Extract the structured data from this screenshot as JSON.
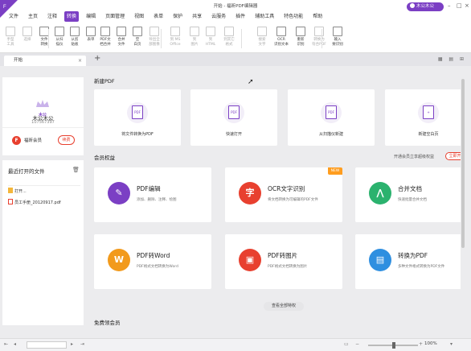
{
  "window": {
    "title": "开始 - 福昕PDF编辑器",
    "user_pill": "木公木公"
  },
  "menu": [
    "文件",
    "主页",
    "注释",
    "转换",
    "编辑",
    "页面管理",
    "视图",
    "表单",
    "保护",
    "共享",
    "云服务",
    "插件",
    "辅助工具",
    "特色功能",
    "帮助"
  ],
  "menu_active_index": 3,
  "toolbar": {
    "items": [
      {
        "label": "手型\n工具",
        "enabled": false
      },
      {
        "label": "选择",
        "enabled": false
      },
      {
        "label": "文件\n转换",
        "enabled": true
      },
      {
        "label": "从扫\n描仪",
        "enabled": true
      },
      {
        "label": "从剪\n贴板",
        "enabled": true
      },
      {
        "label": "表单",
        "enabled": true
      },
      {
        "label": "PDF文\n档合并",
        "enabled": true
      },
      {
        "label": "合并\n文件",
        "enabled": true
      },
      {
        "label": "空\n白页",
        "enabled": true
      },
      {
        "label": "导出全\n部图像",
        "enabled": false
      },
      {
        "label": "到 MS\nOffice",
        "enabled": false
      },
      {
        "label": "到\n图片",
        "enabled": false
      },
      {
        "label": "到\nHTML",
        "enabled": false
      },
      {
        "label": "到其它\n格式",
        "enabled": false
      },
      {
        "label": "搜索\n文字",
        "enabled": false
      },
      {
        "label": "OCR\n识别文本",
        "enabled": true
      },
      {
        "label": "重新\n识别",
        "enabled": true
      },
      {
        "label": "转换为\n符合PDF",
        "enabled": false
      },
      {
        "label": "输入\n要识别",
        "enabled": true
      }
    ]
  },
  "tabs": {
    "doc_tab": "开始",
    "icons": "▦ ▤ ⊞"
  },
  "left": {
    "avatar_text": "木公",
    "user_name": "木公木公",
    "user_id": "107567397",
    "vip_badge": "F",
    "vip_label": "福昕会员",
    "renew_label": "续费",
    "recent_title": "最近打开的文件",
    "recent_files": [
      {
        "name": "打开...",
        "type": "folder"
      },
      {
        "name": "员工手册_20120917.pdf",
        "type": "pdf"
      }
    ]
  },
  "main": {
    "new_pdf_title": "新建PDF",
    "quick": [
      {
        "label": "将文件转换为PDF",
        "icon": "PDF"
      },
      {
        "label": "快速打开",
        "icon": "PDF"
      },
      {
        "label": "从扫描仪新建",
        "icon": "PDF"
      },
      {
        "label": "新建空白页",
        "icon": "+"
      }
    ],
    "benefits_title": "会员权益",
    "benefits_link": "开通会员立享超级权益",
    "benefits_button": "立即开",
    "features": [
      {
        "title": "PDF编辑",
        "desc": "添加、删除、注释、绘图",
        "color": "#7b3fc4",
        "glyph": "✎",
        "new": false
      },
      {
        "title": "OCR文字识别",
        "desc": "将文档转换为可编辑的PDF文件",
        "color": "#e8402f",
        "glyph": "字",
        "new": true
      },
      {
        "title": "合并文档",
        "desc": "快速批量合并文档",
        "color": "#2bb26e",
        "glyph": "⋀",
        "new": false
      },
      {
        "title": "PDF转Word",
        "desc": "PDF格式文档转换为Word",
        "color": "#f29a1c",
        "glyph": "W",
        "new": false
      },
      {
        "title": "PDF转图片",
        "desc": "PDF格式文档转换为图片",
        "color": "#e8402f",
        "glyph": "▣",
        "new": false
      },
      {
        "title": "转换为PDF",
        "desc": "多种文件格式转换为PDF文件",
        "color": "#2f8fe0",
        "glyph": "▤",
        "new": false
      }
    ],
    "new_tag": "NEW",
    "view_all": "查看全部特权",
    "free_title": "免费领会员"
  },
  "status": {
    "zoom": "100%"
  }
}
